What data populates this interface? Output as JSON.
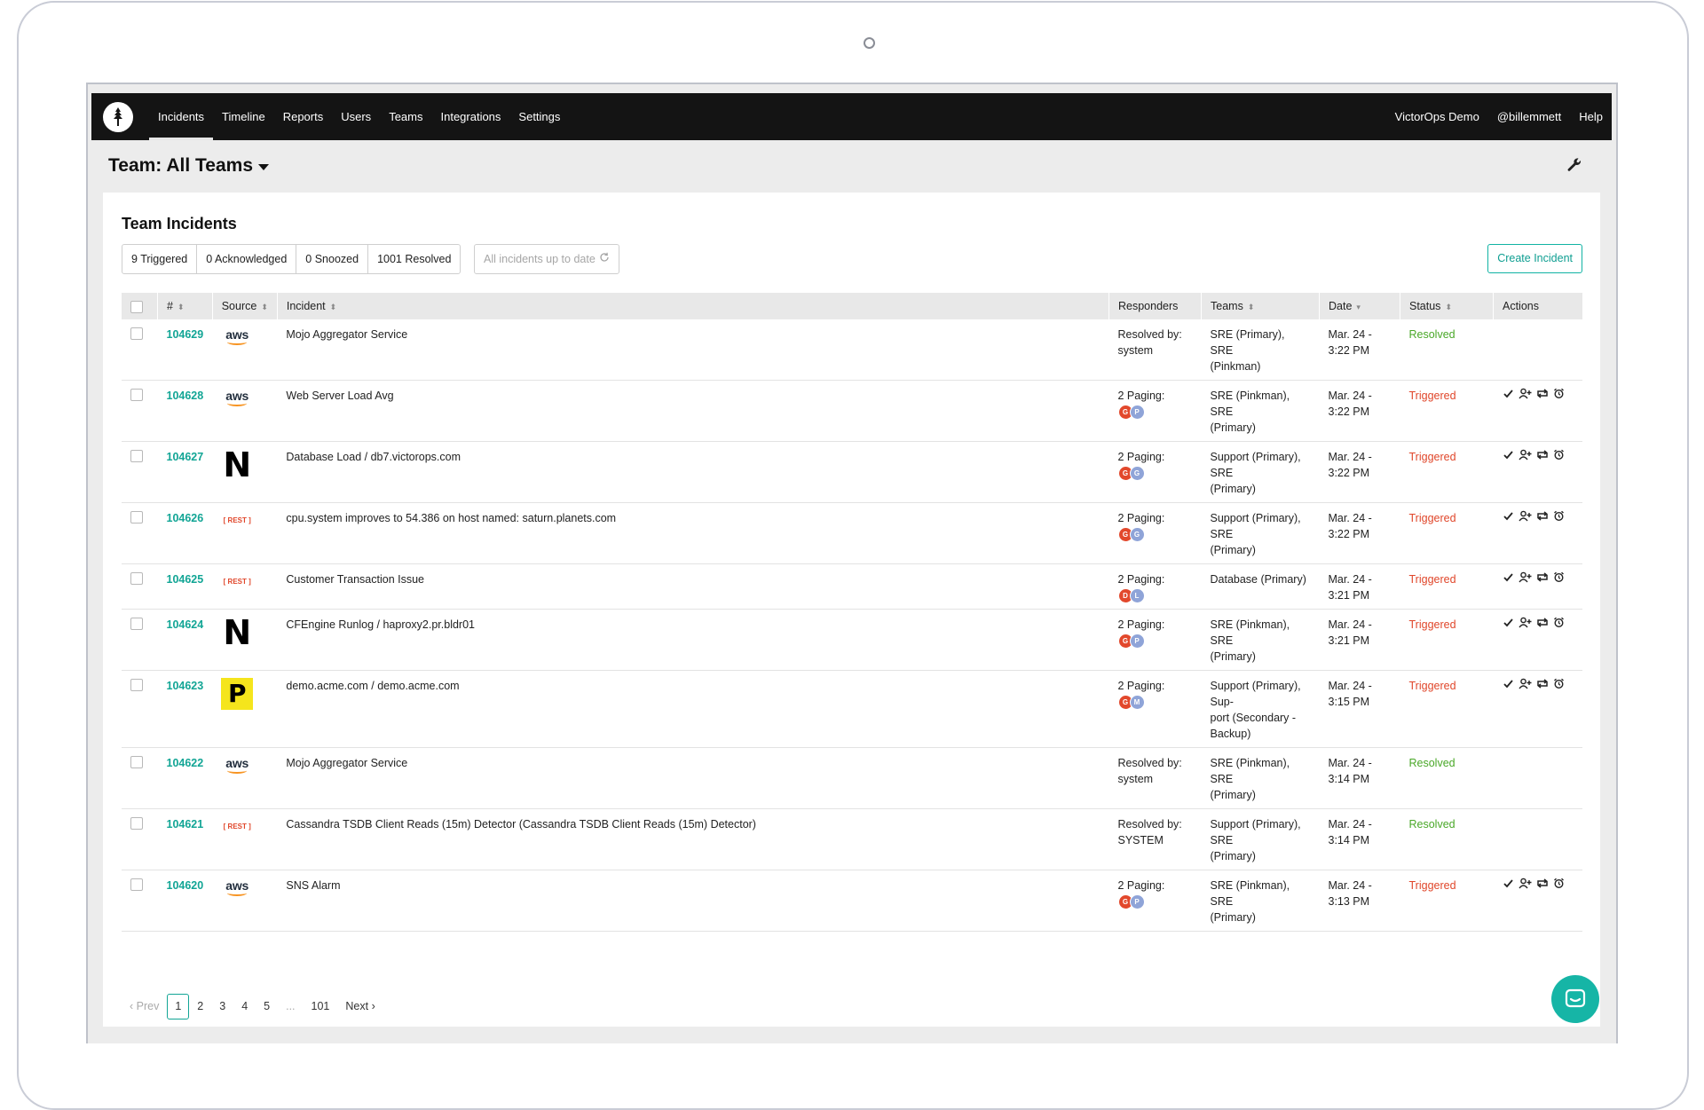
{
  "nav": {
    "items": [
      "Incidents",
      "Timeline",
      "Reports",
      "Users",
      "Teams",
      "Integrations",
      "Settings"
    ],
    "right": [
      "VictorOps Demo",
      "@billemmett",
      "Help"
    ]
  },
  "team_title": "Team: All Teams",
  "card": {
    "title": "Team Incidents",
    "counts": [
      "9 Triggered",
      "0 Acknowledged",
      "0 Snoozed",
      "1001 Resolved"
    ],
    "up_to_date": "All incidents up to date",
    "create_button": "Create Incident"
  },
  "table": {
    "headers": [
      "#",
      "Source",
      "Incident",
      "Responders",
      "Teams",
      "Date",
      "Status",
      "Actions"
    ],
    "rows": [
      {
        "id": "104629",
        "source": "aws",
        "incident": "Mojo Aggregator Service",
        "responder_line": "Resolved by:",
        "responder_detail": "system",
        "avatars": [],
        "teams_1": "SRE (Primary), SRE",
        "teams_2": "(Pinkman)",
        "teams_3": "",
        "date_1": "Mar. 24 -",
        "date_2": "3:22 PM",
        "status": "Resolved"
      },
      {
        "id": "104628",
        "source": "aws",
        "incident": "Web Server Load Avg",
        "responder_line": "2 Paging:",
        "responder_detail": "",
        "avatars": [
          "G",
          "P"
        ],
        "teams_1": "SRE (Pinkman), SRE",
        "teams_2": "(Primary)",
        "teams_3": "",
        "date_1": "Mar. 24 -",
        "date_2": "3:22 PM",
        "status": "Triggered"
      },
      {
        "id": "104627",
        "source": "newrelic",
        "incident": "Database Load / db7.victorops.com",
        "responder_line": "2 Paging:",
        "responder_detail": "",
        "avatars": [
          "G",
          "G"
        ],
        "teams_1": "Support (Primary), SRE",
        "teams_2": "(Primary)",
        "teams_3": "",
        "date_1": "Mar. 24 -",
        "date_2": "3:22 PM",
        "status": "Triggered"
      },
      {
        "id": "104626",
        "source": "rest",
        "incident": "cpu.system improves to 54.386 on host named: saturn.planets.com",
        "responder_line": "2 Paging:",
        "responder_detail": "",
        "avatars": [
          "G",
          "G"
        ],
        "teams_1": "Support (Primary), SRE",
        "teams_2": "(Primary)",
        "teams_3": "",
        "date_1": "Mar. 24 -",
        "date_2": "3:22 PM",
        "status": "Triggered"
      },
      {
        "id": "104625",
        "source": "rest",
        "incident": "Customer Transaction Issue",
        "responder_line": "2 Paging:",
        "responder_detail": "",
        "avatars": [
          "D",
          "L"
        ],
        "teams_1": "Database (Primary)",
        "teams_2": "",
        "teams_3": "",
        "date_1": "Mar. 24 -",
        "date_2": "3:21 PM",
        "status": "Triggered"
      },
      {
        "id": "104624",
        "source": "newrelic",
        "incident": "CFEngine Runlog / haproxy2.pr.bldr01",
        "responder_line": "2 Paging:",
        "responder_detail": "",
        "avatars": [
          "G",
          "P"
        ],
        "teams_1": "SRE (Pinkman), SRE",
        "teams_2": "(Primary)",
        "teams_3": "",
        "date_1": "Mar. 24 -",
        "date_2": "3:21 PM",
        "status": "Triggered"
      },
      {
        "id": "104623",
        "source": "pingdom",
        "incident": "demo.acme.com / demo.acme.com",
        "responder_line": "2 Paging:",
        "responder_detail": "",
        "avatars": [
          "G",
          "M"
        ],
        "teams_1": "Support (Primary), Sup-",
        "teams_2": "port (Secondary -",
        "teams_3": "Backup)",
        "date_1": "Mar. 24 -",
        "date_2": "3:15 PM",
        "status": "Triggered"
      },
      {
        "id": "104622",
        "source": "aws",
        "incident": "Mojo Aggregator Service",
        "responder_line": "Resolved by:",
        "responder_detail": "system",
        "avatars": [],
        "teams_1": "SRE (Pinkman), SRE",
        "teams_2": "(Primary)",
        "teams_3": "",
        "date_1": "Mar. 24 -",
        "date_2": "3:14 PM",
        "status": "Resolved"
      },
      {
        "id": "104621",
        "source": "rest",
        "incident": "Cassandra TSDB Client Reads (15m) Detector (Cassandra TSDB Client Reads (15m) Detector)",
        "responder_line": "Resolved by:",
        "responder_detail": "SYSTEM",
        "avatars": [],
        "teams_1": "Support (Primary), SRE",
        "teams_2": "(Primary)",
        "teams_3": "",
        "date_1": "Mar. 24 -",
        "date_2": "3:14 PM",
        "status": "Resolved"
      },
      {
        "id": "104620",
        "source": "aws",
        "incident": "SNS Alarm",
        "responder_line": "2 Paging:",
        "responder_detail": "",
        "avatars": [
          "G",
          "P"
        ],
        "teams_1": "SRE (Pinkman), SRE",
        "teams_2": "(Primary)",
        "teams_3": "",
        "date_1": "Mar. 24 -",
        "date_2": "3:13 PM",
        "status": "Triggered"
      }
    ]
  },
  "source_labels": {
    "aws": "aws",
    "newrelic": "N",
    "rest": "[ REST ]",
    "pingdom": "P"
  },
  "pagination": {
    "prev": "‹ Prev",
    "pages": [
      "1",
      "2",
      "3",
      "4",
      "5",
      "...",
      "101"
    ],
    "next": "Next ›",
    "active": "1"
  },
  "colors": {
    "accent": "#12a595",
    "triggered": "#e0462a",
    "resolved": "#4aa828",
    "navbar": "#141414"
  },
  "icons": [
    "victorops-logo-icon",
    "wrench-icon",
    "refresh-icon",
    "checkmark-icon",
    "add-user-icon",
    "reroute-icon",
    "snooze-alarm-icon",
    "chat-icon"
  ]
}
